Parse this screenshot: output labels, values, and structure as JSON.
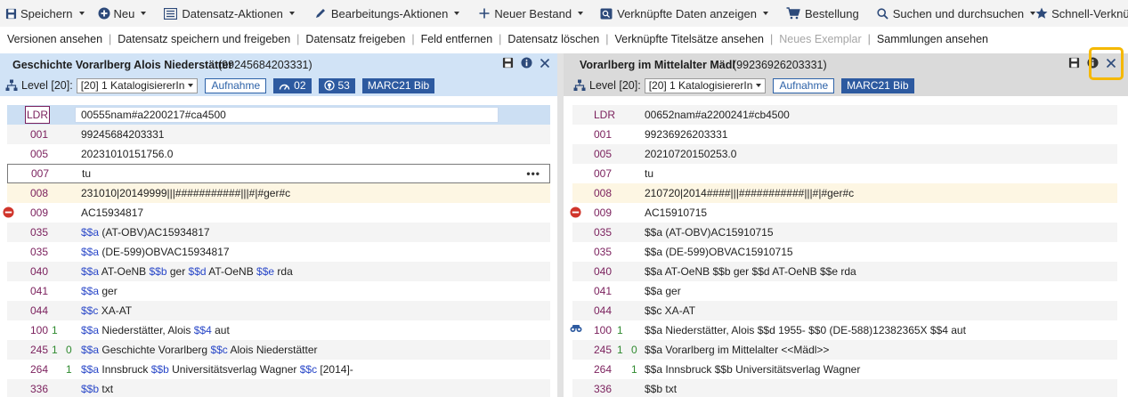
{
  "toolbar": {
    "save": "Speichern",
    "new": "Neu",
    "record_actions": "Datensatz-Aktionen",
    "edit_actions": "Bearbeitungs-Aktionen",
    "new_holding": "Neuer Bestand",
    "show_linked": "Verknüpfte Daten anzeigen",
    "order": "Bestellung",
    "search": "Suchen und durchsuchen",
    "quick_links": "Schnell-Verknüpfungen"
  },
  "actions": [
    "Versionen ansehen",
    "Datensatz speichern und freigeben",
    "Datensatz freigeben",
    "Feld entfernen",
    "Datensatz löschen",
    "Verknüpfte Titelsätze ansehen",
    "Neues Exemplar",
    "Sammlungen ansehen"
  ],
  "left": {
    "title": "Geschichte Vorarlberg Alois Niederstätter",
    "record_id": "(99245684203331)",
    "level_label": "Level [20]:",
    "level_value": "[20] 1 KatalogisiererIn",
    "aufnahme": "Aufnahme",
    "count_a": "02",
    "count_b": "53",
    "format": "MARC21 Bib",
    "rows": [
      {
        "tag": "LDR",
        "i1": "",
        "i2": "",
        "content": "00555nam#a2200217#ca4500"
      },
      {
        "tag": "001",
        "i1": "",
        "i2": "",
        "content": "99245684203331"
      },
      {
        "tag": "005",
        "i1": "",
        "i2": "",
        "content": "20231010151756.0"
      },
      {
        "tag": "007",
        "i1": "",
        "i2": "",
        "content": "tu"
      },
      {
        "tag": "008",
        "i1": "",
        "i2": "",
        "content": "231010|20149999|||###########|||#|#ger#c"
      },
      {
        "tag": "009",
        "i1": "",
        "i2": "",
        "content": "AC15934817"
      },
      {
        "tag": "035",
        "i1": "",
        "i2": "",
        "content": "$$a (AT-OBV)AC15934817"
      },
      {
        "tag": "035",
        "i1": "",
        "i2": "",
        "content": "$$a (DE-599)OBVAC15934817"
      },
      {
        "tag": "040",
        "i1": "",
        "i2": "",
        "content": "$$a AT-OeNB $$b ger $$d AT-OeNB $$e rda"
      },
      {
        "tag": "041",
        "i1": "",
        "i2": "",
        "content": "$$a ger"
      },
      {
        "tag": "044",
        "i1": "",
        "i2": "",
        "content": "$$c XA-AT"
      },
      {
        "tag": "100",
        "i1": "1",
        "i2": "",
        "content": "$$a Niederstätter, Alois $$4 aut"
      },
      {
        "tag": "245",
        "i1": "1",
        "i2": "0",
        "content": "$$a Geschichte Vorarlberg $$c Alois Niederstätter"
      },
      {
        "tag": "264",
        "i1": "",
        "i2": "1",
        "content": "$$a Innsbruck $$b Universitätsverlag Wagner $$c [2014]-"
      },
      {
        "tag": "336",
        "i1": "",
        "i2": "",
        "content": "$$b txt"
      }
    ]
  },
  "right": {
    "title": "Vorarlberg im Mittelalter Mädl",
    "record_id": "(99236926203331)",
    "level_label": "Level [20]:",
    "level_value": "[20] 1 KatalogisiererIn",
    "aufnahme": "Aufnahme",
    "format": "MARC21 Bib",
    "rows": [
      {
        "tag": "LDR",
        "i1": "",
        "i2": "",
        "content": "00652nam#a2200241#cb4500"
      },
      {
        "tag": "001",
        "i1": "",
        "i2": "",
        "content": "99236926203331"
      },
      {
        "tag": "005",
        "i1": "",
        "i2": "",
        "content": "20210720150253.0"
      },
      {
        "tag": "007",
        "i1": "",
        "i2": "",
        "content": "tu"
      },
      {
        "tag": "008",
        "i1": "",
        "i2": "",
        "content": "210720|2014####|||###########|||#|#ger#c"
      },
      {
        "tag": "009",
        "i1": "",
        "i2": "",
        "content": "AC15910715"
      },
      {
        "tag": "035",
        "i1": "",
        "i2": "",
        "content": "$$a (AT-OBV)AC15910715"
      },
      {
        "tag": "035",
        "i1": "",
        "i2": "",
        "content": "$$a (DE-599)OBVAC15910715"
      },
      {
        "tag": "040",
        "i1": "",
        "i2": "",
        "content": "$$a AT-OeNB $$b ger $$d AT-OeNB $$e rda"
      },
      {
        "tag": "041",
        "i1": "",
        "i2": "",
        "content": "$$a ger"
      },
      {
        "tag": "044",
        "i1": "",
        "i2": "",
        "content": "$$c XA-AT"
      },
      {
        "tag": "100",
        "i1": "1",
        "i2": "",
        "content": "$$a Niederstätter, Alois $$d 1955- $$0 (DE-588)12382365X $$4 aut"
      },
      {
        "tag": "245",
        "i1": "1",
        "i2": "0",
        "content": "$$a Vorarlberg im Mittelalter <<Mädl>>"
      },
      {
        "tag": "264",
        "i1": "",
        "i2": "1",
        "content": "$$a Innsbruck $$b Universitätsverlag Wagner"
      },
      {
        "tag": "336",
        "i1": "",
        "i2": "",
        "content": "$$b txt"
      }
    ]
  },
  "colors": {
    "accent_blue": "#2d5aa0",
    "tag_color": "#7a1f5c",
    "subfield_color": "#2a48c8",
    "indicator_color": "#2f8a2f",
    "highlight": "#f5b800",
    "remove_red": "#d0352b"
  }
}
